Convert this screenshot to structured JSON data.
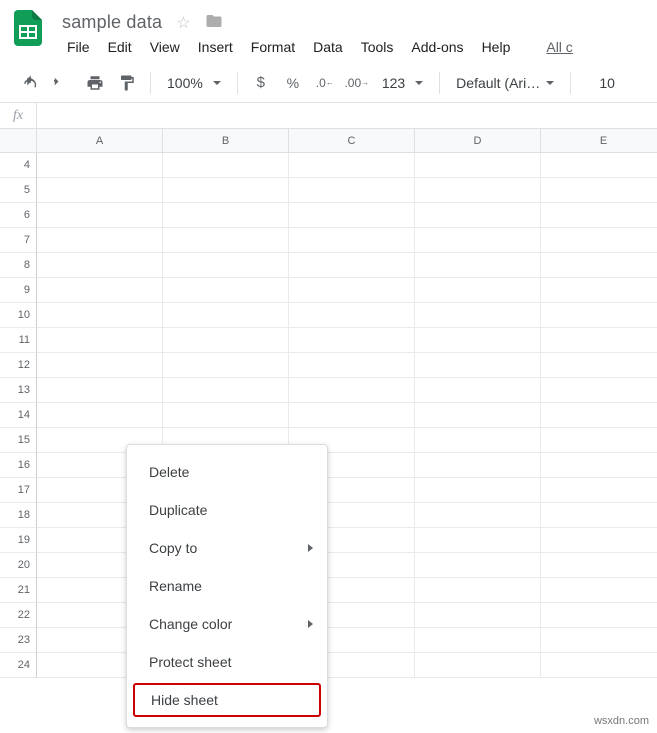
{
  "doc": {
    "title": "sample data"
  },
  "menubar": [
    "File",
    "Edit",
    "View",
    "Insert",
    "Format",
    "Data",
    "Tools",
    "Add-ons",
    "Help",
    "All c"
  ],
  "toolbar": {
    "zoom": "100%",
    "format_num": "123",
    "font": "Default (Ari…",
    "font_size": "10"
  },
  "cols": [
    "A",
    "B",
    "C",
    "D",
    "E"
  ],
  "rows": [
    "4",
    "5",
    "6",
    "7",
    "8",
    "9",
    "10",
    "11",
    "12",
    "13",
    "14",
    "15",
    "16",
    "17",
    "18",
    "19",
    "20",
    "21",
    "22",
    "23",
    "24"
  ],
  "context_menu": [
    {
      "label": "Delete",
      "arrow": false
    },
    {
      "label": "Duplicate",
      "arrow": false
    },
    {
      "label": "Copy to",
      "arrow": true
    },
    {
      "label": "Rename",
      "arrow": false
    },
    {
      "label": "Change color",
      "arrow": true
    },
    {
      "label": "Protect sheet",
      "arrow": false
    },
    {
      "label": "Hide sheet",
      "arrow": false,
      "highlight": true
    }
  ],
  "watermark": "wsxdn.com"
}
